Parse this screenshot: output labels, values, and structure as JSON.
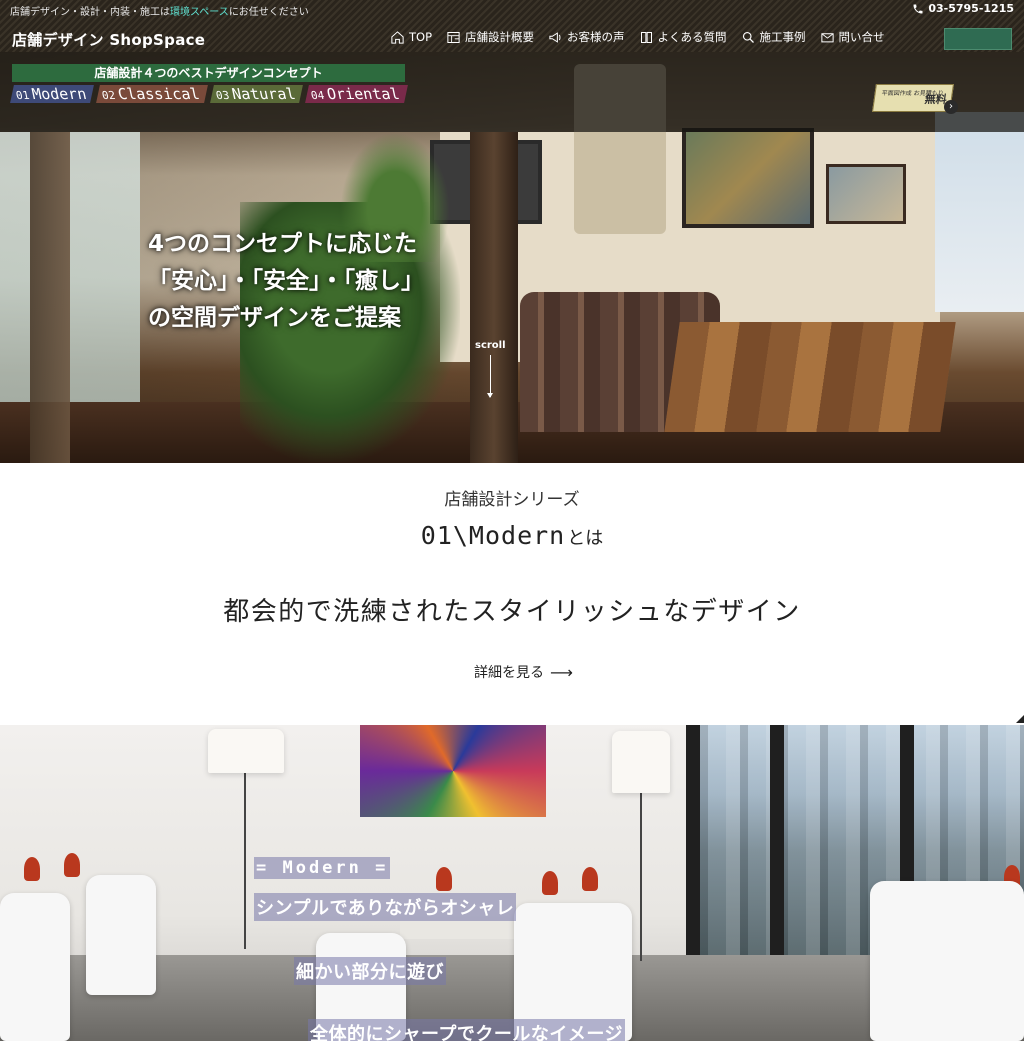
{
  "header": {
    "tagline_prefix": "店舗デザイン・設計・内装・施工は",
    "tagline_highlight": "環境スペース",
    "tagline_suffix": "にお任せください",
    "phone": "03-5795-1215",
    "logo": "店舗デザイン ShopSpace",
    "nav": [
      {
        "label": "TOP",
        "icon": "home-icon"
      },
      {
        "label": "店舗設計概要",
        "icon": "blueprint-icon"
      },
      {
        "label": "お客様の声",
        "icon": "megaphone-icon"
      },
      {
        "label": "よくある質問",
        "icon": "book-icon"
      },
      {
        "label": "施工事例",
        "icon": "search-icon"
      },
      {
        "label": "問い合せ",
        "icon": "mail-icon"
      }
    ]
  },
  "hero": {
    "concept_title": "店舗設計４つのベストデザインコンセプト",
    "tabs": [
      {
        "num": "01",
        "label": "Modern"
      },
      {
        "num": "02",
        "label": "Classical"
      },
      {
        "num": "03",
        "label": "Natural"
      },
      {
        "num": "04",
        "label": "Oriental"
      }
    ],
    "badge_small": "平面図作成 お見積もり",
    "badge_big": "無料",
    "headline_1": "4つのコンセプトに応じた",
    "headline_2": "「安心」・「安全」・「癒し」",
    "headline_3": "の空間デザインをご提案",
    "scroll_label": "scroll"
  },
  "intro": {
    "series_label": "店舗設計シリーズ",
    "series_title": "01\\Modern",
    "series_title_suffix": "とは",
    "description": "都会的で洗練されたスタイリッシュなデザイン",
    "detail_link": "詳細を見る"
  },
  "modern": {
    "heading": "= Modern =",
    "line_1": "シンプルでありながらオシャレ",
    "line_2": "細かい部分に遊び",
    "line_3": "全体的にシャープでクールなイメージ"
  },
  "colors": {
    "header_bg": "#2a241c",
    "concept_bar": "#2d6b3e",
    "highlight_text": "#5ee0d0",
    "tab_modern": "#3e4a78",
    "tab_classical": "#7a4a3a",
    "tab_natural": "#5a6a38",
    "tab_oriental": "#7a2a4a"
  }
}
